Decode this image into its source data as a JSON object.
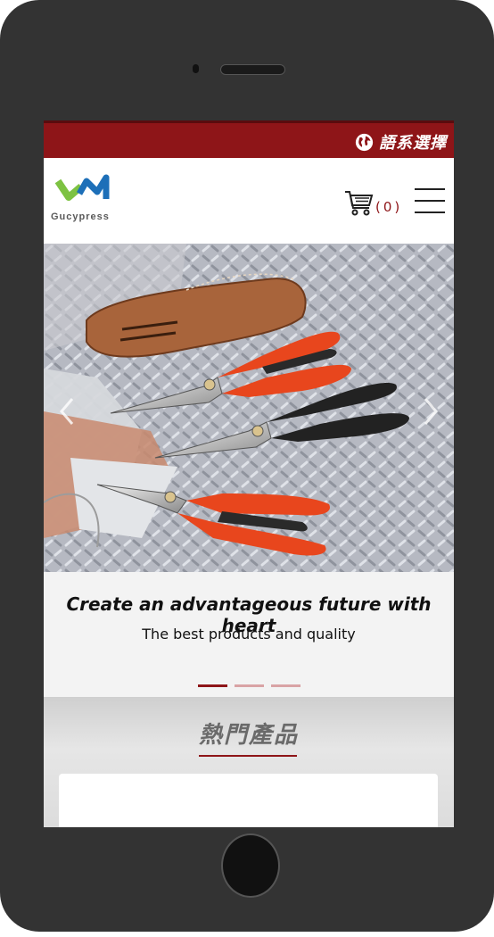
{
  "topbar": {
    "language_label": "語系選擇",
    "icon": "globe-icon"
  },
  "header": {
    "logo_text": "Gucypress",
    "cart_count": "(0)",
    "cart_icon": "cart-icon",
    "menu_icon": "hamburger-menu-icon"
  },
  "banner": {
    "image": "pruning-shears-products-photo",
    "title": "Create an advantageous future with heart",
    "subtitle": "The best products and quality",
    "active_slide": 1,
    "slide_count": 3
  },
  "hot_products": {
    "title": "熱門產品"
  },
  "colors": {
    "brand_red": "#8e1518",
    "orange": "#e8461d",
    "logo_green": "#7dc242",
    "logo_blue": "#1d6fb8"
  }
}
